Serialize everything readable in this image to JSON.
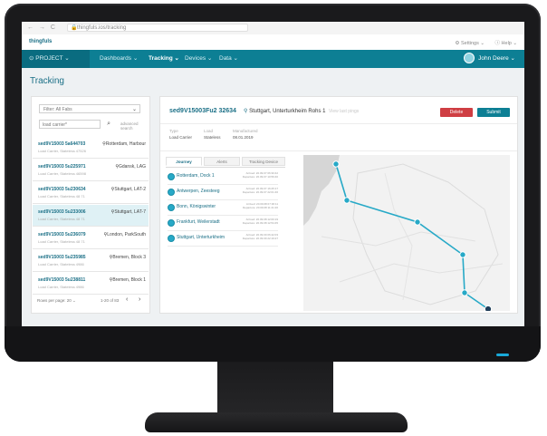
{
  "browser": {
    "nav_arrows": "← → C",
    "url": "thingfuls.ios/tracking"
  },
  "app": {
    "logo": "thingfuls",
    "settings": "⚙ Settings ⌄",
    "help": "ⓘ Help ⌄"
  },
  "nav": {
    "project": "⊙ PROJECT ⌄",
    "items": [
      {
        "label": "Dashboards ⌄"
      },
      {
        "label": "Tracking ⌄"
      },
      {
        "label": "Devices ⌄"
      },
      {
        "label": "Data ⌄"
      }
    ],
    "user": "John Deere ⌄"
  },
  "page": {
    "title": "Tracking"
  },
  "list": {
    "filter": "Filter: All Fabs",
    "search_placeholder": "load carrier*",
    "advanced": "advanced search",
    "items": [
      {
        "id": "sed9V15003 5a644703",
        "sub": "Load Carrier, Stateless 47526",
        "loc": "Rotterdam, Harbour"
      },
      {
        "id": "sed9V15003 5u225971",
        "sub": "Load Carrier, Stateless 46598",
        "loc": "Gdansk, LAG"
      },
      {
        "id": "sed9V15003 5u230634",
        "sub": "Load Carrier, Stateless 48 71",
        "loc": "Stuttgart, LAT-2"
      },
      {
        "id": "sed9V15003 5u233006",
        "sub": "Load Carrier, Stateless 48 71",
        "loc": "Stuttgart, LAT-7"
      },
      {
        "id": "sed9V15003 5u236079",
        "sub": "Load Carrier, Stateless 48 71",
        "loc": "London, ParkSouth"
      },
      {
        "id": "sed9V15003 5u235985",
        "sub": "Load Carrier, Stateless 4986",
        "loc": "Bremen, Block 3"
      },
      {
        "id": "sed9V15003 5u238811",
        "sub": "Load Carrier, Stateless 4986",
        "loc": "Bremen, Block 1"
      }
    ],
    "rows_per_page": "Rows per page: 20 ⌄",
    "range": "1-20 of 83",
    "prev": "‹",
    "next": "›"
  },
  "detail": {
    "id": "sed9V15003Fu2 32634",
    "location": "Stuttgart, Unterturkheim Rohs 1",
    "faint": "View last pings",
    "delete_label": "Delete",
    "submit_label": "Submit",
    "meta": [
      {
        "label": "Type",
        "value": "Load Carrier"
      },
      {
        "label": "Load",
        "value": "Stateless"
      },
      {
        "label": "Manufactured",
        "value": "08.01.2019"
      }
    ],
    "tabs": [
      "Journey",
      "Alerts",
      "Tracking Device"
    ],
    "stops": [
      {
        "name": "Rotterdam, Dock 1",
        "arrival": "Arrived: 20.09.07 06:30:42",
        "departure": "Departure: 20.09.07 10:59:40"
      },
      {
        "name": "Antwerpen, Zeesteeg",
        "arrival": "Arrived: 20.09.07 16:25:17",
        "departure": "Departure: 20.09.07 22:01:46"
      },
      {
        "name": "Bonn, Königswinter",
        "arrival": "Arrived: 20.09.08 07:30:11",
        "departure": "Departure: 20.09.08 11:41:20"
      },
      {
        "name": "Frankfurt, Weilerstadt",
        "arrival": "Arrived: 20.09.08 12:00:19",
        "departure": "Departure: 20.09.08 12:54:45"
      },
      {
        "name": "Stuttgart, Unterturkheim",
        "arrival": "Arrived: 20.09.09 06:42:03",
        "departure": "Departure: 20.09.09 22:19:27"
      }
    ]
  },
  "colors": {
    "accent": "#0d7f94",
    "delete": "#cf3e43",
    "route": "#27a9c7"
  }
}
